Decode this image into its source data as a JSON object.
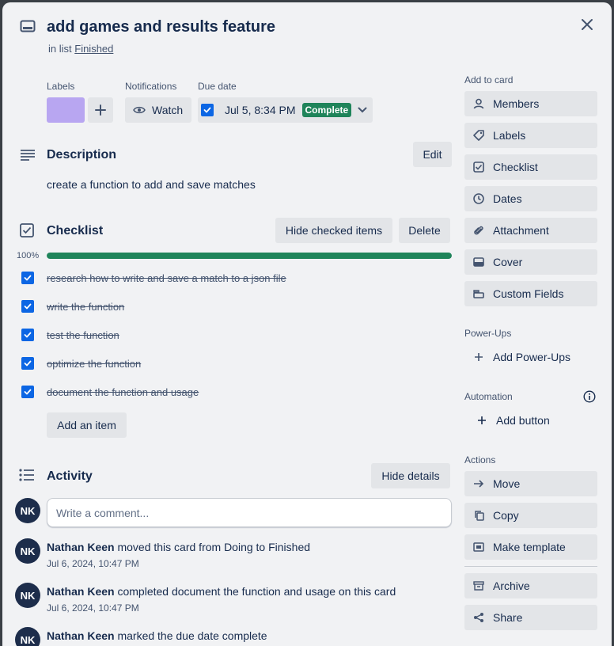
{
  "card": {
    "title": "add games and results feature",
    "in_list_prefix": "in list",
    "list_name": "Finished"
  },
  "meta": {
    "labels_heading": "Labels",
    "notifications_heading": "Notifications",
    "watch_label": "Watch",
    "due_heading": "Due date",
    "due_value": "Jul 5, 8:34 PM",
    "due_status": "Complete",
    "label_color": "#b8a6f1"
  },
  "description": {
    "heading": "Description",
    "edit_label": "Edit",
    "text": "create a function to add and save matches"
  },
  "checklist": {
    "heading": "Checklist",
    "hide_checked_label": "Hide checked items",
    "delete_label": "Delete",
    "progress_text": "100%",
    "progress_fraction": 1.0,
    "items": [
      {
        "text": "research how to write and save a match to a json file",
        "checked": true
      },
      {
        "text": "write the function",
        "checked": true
      },
      {
        "text": "test the function",
        "checked": true
      },
      {
        "text": "optimize the function",
        "checked": true
      },
      {
        "text": "document the function and usage",
        "checked": true
      }
    ],
    "add_item_label": "Add an item"
  },
  "activity": {
    "heading": "Activity",
    "hide_details_label": "Hide details",
    "comment_placeholder": "Write a comment...",
    "user_initials": "NK",
    "entries": [
      {
        "user": "Nathan Keen",
        "action": "moved this card from Doing to Finished",
        "time": "Jul 6, 2024, 10:47 PM"
      },
      {
        "user": "Nathan Keen",
        "action": "completed document the function and usage on this card",
        "time": "Jul 6, 2024, 10:47 PM"
      },
      {
        "user": "Nathan Keen",
        "action": "marked the due date complete",
        "time": ""
      }
    ]
  },
  "sidebar": {
    "add_to_card_heading": "Add to card",
    "add_to_card": [
      {
        "label": "Members",
        "icon": "person-icon"
      },
      {
        "label": "Labels",
        "icon": "tag-icon"
      },
      {
        "label": "Checklist",
        "icon": "checkbox-icon"
      },
      {
        "label": "Dates",
        "icon": "clock-icon"
      },
      {
        "label": "Attachment",
        "icon": "paperclip-icon"
      },
      {
        "label": "Cover",
        "icon": "cover-icon"
      },
      {
        "label": "Custom Fields",
        "icon": "custom-fields-icon"
      }
    ],
    "powerups_heading": "Power-Ups",
    "add_powerups_label": "Add Power-Ups",
    "automation_heading": "Automation",
    "add_button_label": "Add button",
    "actions_heading": "Actions",
    "actions": [
      {
        "label": "Move",
        "icon": "arrow-right-icon"
      },
      {
        "label": "Copy",
        "icon": "copy-icon"
      },
      {
        "label": "Make template",
        "icon": "template-icon"
      },
      {
        "label": "Archive",
        "icon": "archive-icon"
      },
      {
        "label": "Share",
        "icon": "share-icon"
      }
    ]
  },
  "colors": {
    "accent": "#0c66e4",
    "complete_green": "#1f845a",
    "avatar_bg": "#1d2d4b"
  }
}
